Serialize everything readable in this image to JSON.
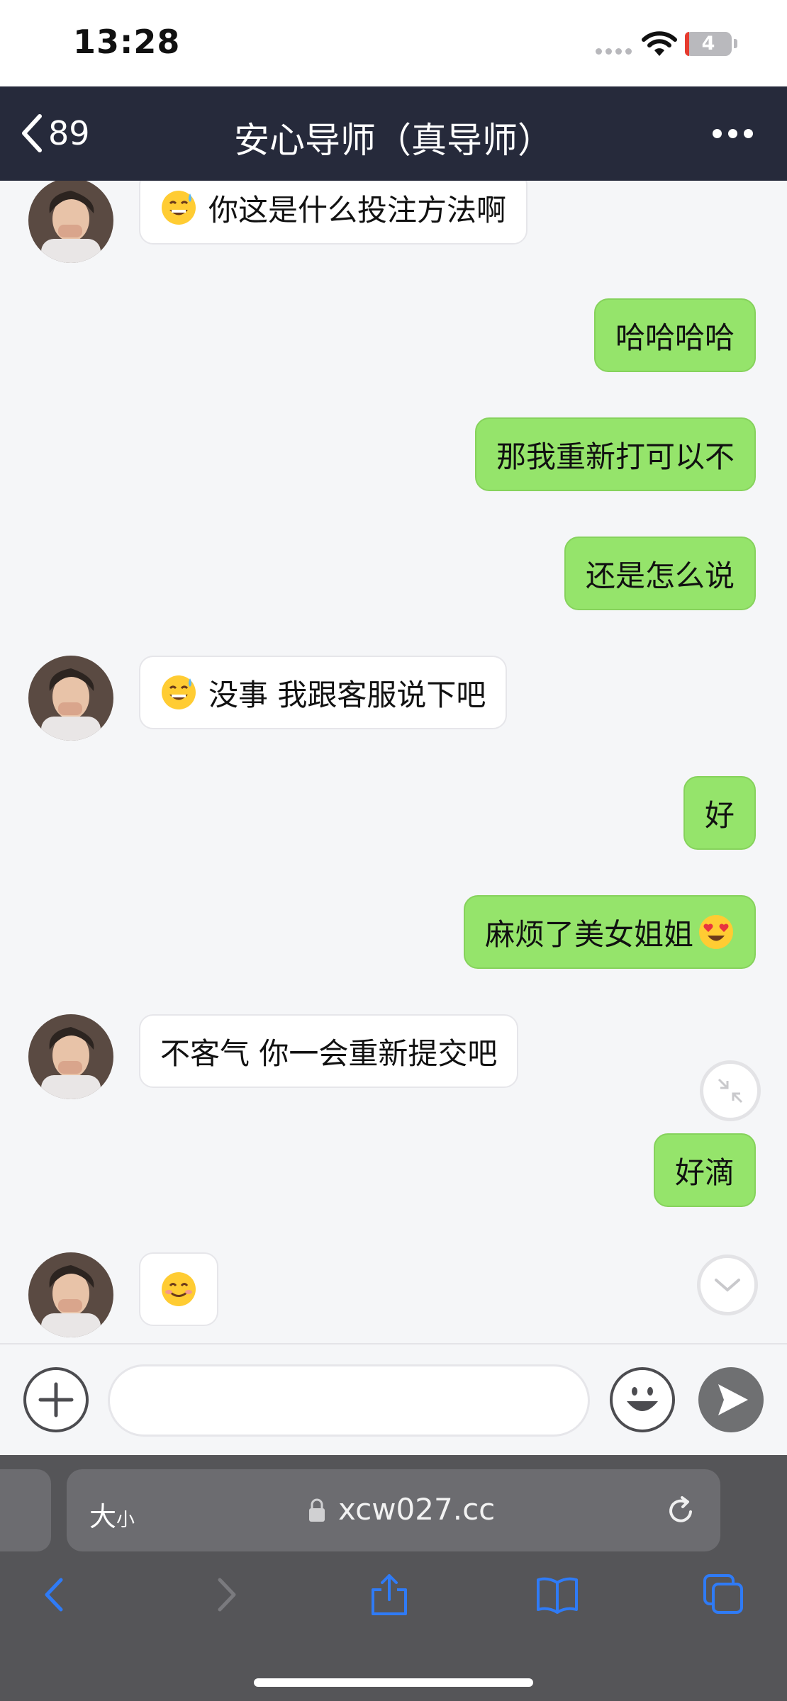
{
  "status_bar": {
    "time": "13:28",
    "battery": "4"
  },
  "header": {
    "back_count": "89",
    "title": "安心导师（真导师）"
  },
  "messages": [
    {
      "side": "in",
      "emoji": "sweat-smile",
      "text": "你这是什么投注方法啊"
    },
    {
      "side": "out",
      "text": "哈哈哈哈"
    },
    {
      "side": "out",
      "text": "那我重新打可以不"
    },
    {
      "side": "out",
      "text": "还是怎么说"
    },
    {
      "side": "in",
      "emoji": "sweat-smile",
      "text": "没事 我跟客服说下吧"
    },
    {
      "side": "out",
      "text": "好"
    },
    {
      "side": "out",
      "text": "麻烦了美女姐姐",
      "emoji_after": "heart-eyes"
    },
    {
      "side": "in",
      "text": "不客气 你一会重新提交吧"
    },
    {
      "side": "out",
      "text": "好滴"
    },
    {
      "side": "in",
      "emoji": "smile",
      "text": ""
    }
  ],
  "composer": {
    "placeholder": ""
  },
  "browser": {
    "text_size_big": "大",
    "text_size_small": "小",
    "url": "xcw027.cc"
  },
  "colors": {
    "header_bg": "#262a3b",
    "outgoing_bubble": "#95e46b",
    "incoming_bubble": "#ffffff",
    "chat_bg": "#f5f6f8",
    "link_blue": "#2f7bf6"
  }
}
